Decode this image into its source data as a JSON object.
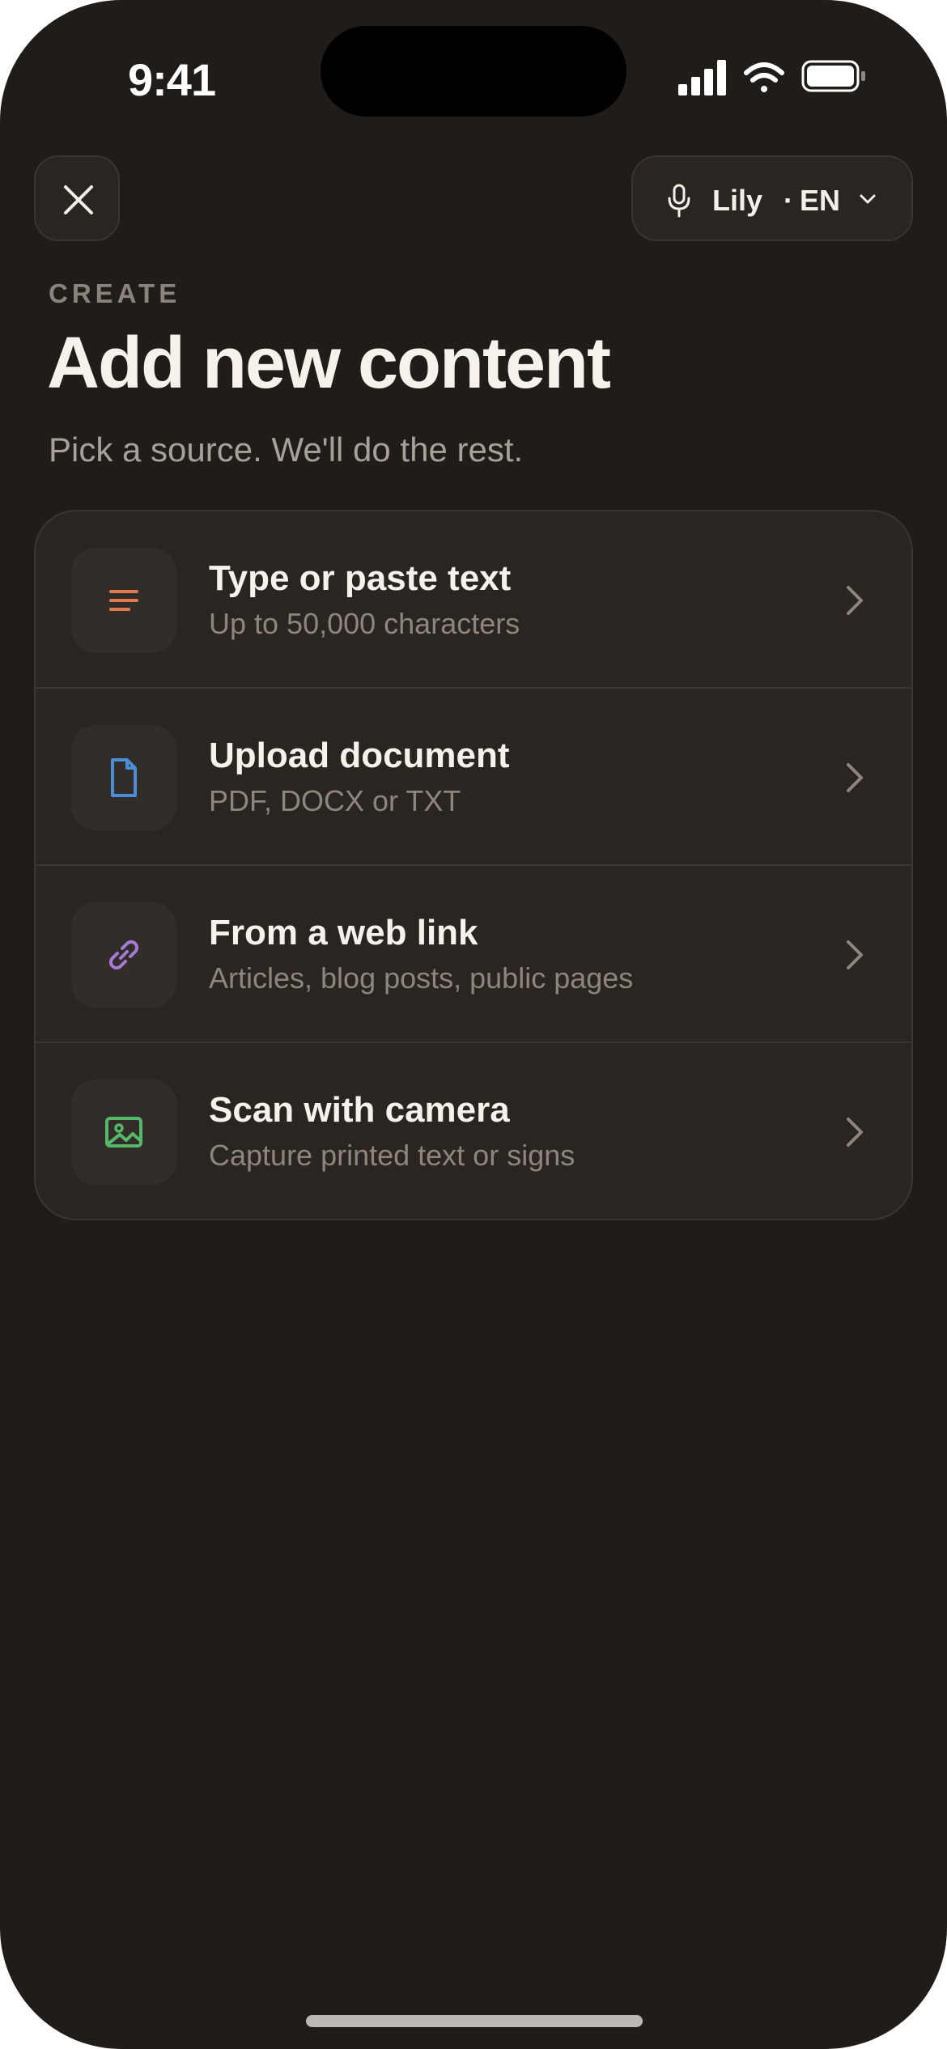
{
  "status_bar": {
    "time": "9:41"
  },
  "header": {
    "voice_name": "Lily",
    "separator": "·",
    "language": "EN"
  },
  "page": {
    "eyebrow": "CREATE",
    "title": "Add new content",
    "subtitle": "Pick a source. We'll do the rest."
  },
  "sources": [
    {
      "title": "Type or paste text",
      "subtitle": "Up to 50,000 characters",
      "icon": "text-lines-icon",
      "color": "#e07a4f"
    },
    {
      "title": "Upload document",
      "subtitle": "PDF, DOCX or TXT",
      "icon": "document-icon",
      "color": "#4a8fd6"
    },
    {
      "title": "From a web link",
      "subtitle": "Articles, blog posts, public pages",
      "icon": "link-icon",
      "color": "#a57bd6"
    },
    {
      "title": "Scan with camera",
      "subtitle": "Capture printed text or signs",
      "icon": "image-icon",
      "color": "#55b86a"
    }
  ],
  "colors": {
    "background": "#201c19",
    "card": "#2a2521",
    "text_primary": "#f6f1eb",
    "text_secondary": "#8c867f"
  }
}
